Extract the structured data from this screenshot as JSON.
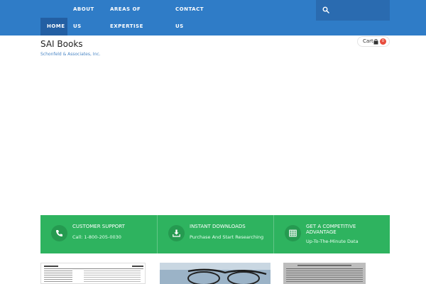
{
  "nav": {
    "home": "HOME",
    "about_line1": "ABOUT",
    "about_line2": "US",
    "areas_line1": "AREAS OF",
    "areas_line2": "EXPERTISE",
    "contact_line1": "CONTACT",
    "contact_line2": "US"
  },
  "search": {
    "icon": "search-icon"
  },
  "brand": {
    "title": "SAI Books",
    "subtitle": "Schonfeld & Associates, Inc."
  },
  "cart": {
    "label": "Cart",
    "icon": "shopping-bag-icon",
    "count": "0"
  },
  "features": [
    {
      "icon": "phone-icon",
      "title": "CUSTOMER SUPPORT",
      "text": "Call: 1-800-205-0030"
    },
    {
      "icon": "download-icon",
      "title": "INSTANT DOWNLOADS",
      "text": "Purchase And Start Researching"
    },
    {
      "icon": "table-icon",
      "title": "GET A COMPETITIVE ADVANTAGE",
      "text": "Up-To-The-Minute Data"
    }
  ],
  "colors": {
    "nav_bg": "#2f7cc7",
    "nav_active": "#235fa3",
    "feature_bg": "#2eb35f",
    "badge": "#e74c3c"
  }
}
